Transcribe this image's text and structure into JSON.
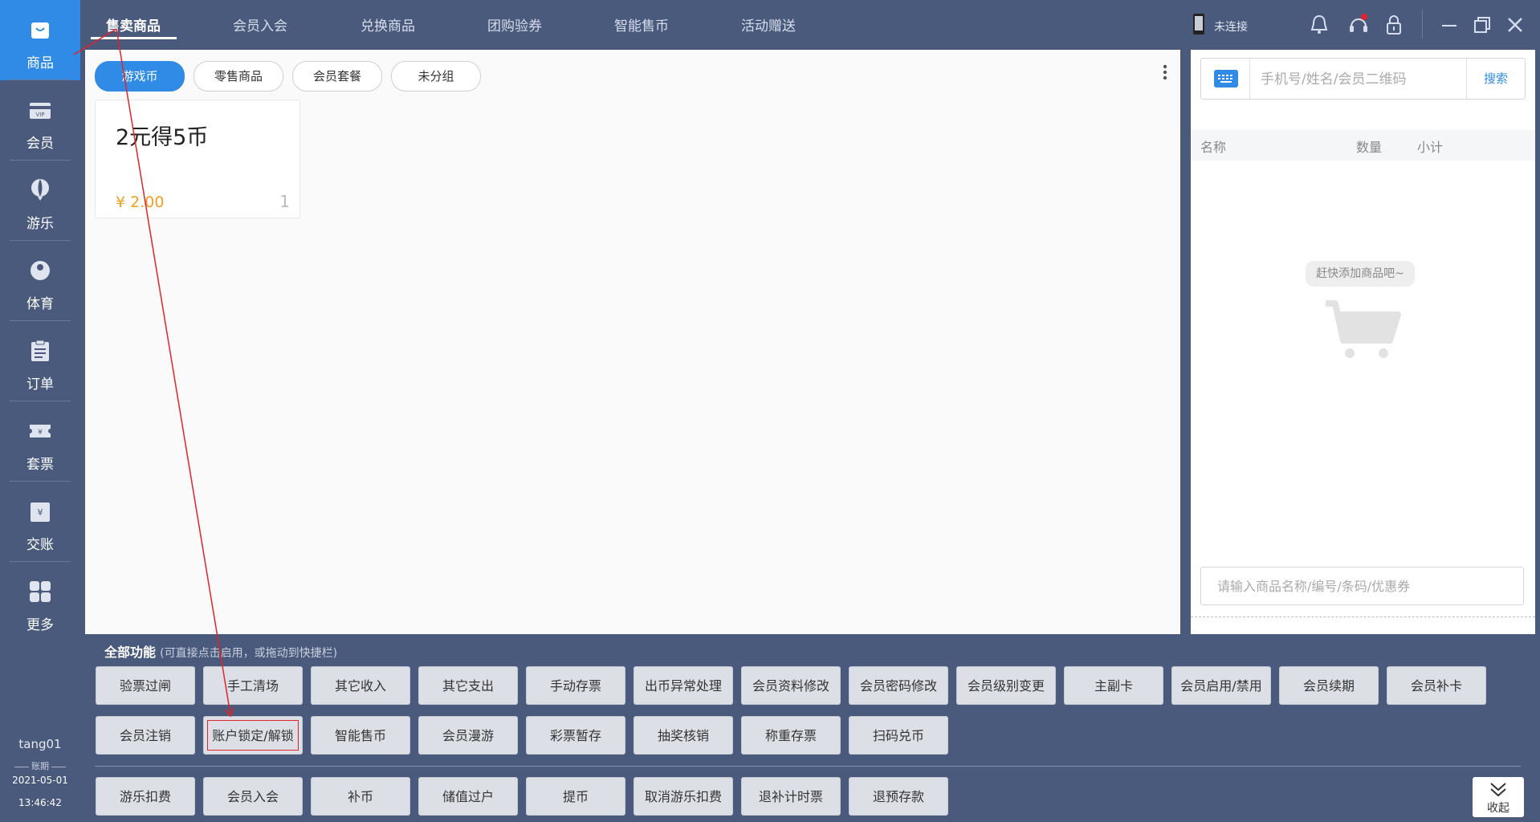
{
  "sidebar": {
    "items": [
      {
        "label": "商品",
        "icon": "shopping-bag-icon"
      },
      {
        "label": "会员",
        "icon": "vip-card-icon"
      },
      {
        "label": "游乐",
        "icon": "balloon-icon"
      },
      {
        "label": "体育",
        "icon": "billiard-ball-icon"
      },
      {
        "label": "订单",
        "icon": "clipboard-icon"
      },
      {
        "label": "套票",
        "icon": "ticket-icon"
      },
      {
        "label": "交账",
        "icon": "cash-icon"
      },
      {
        "label": "更多",
        "icon": "grid-icon"
      }
    ],
    "user": "tang01",
    "period_label": "账期",
    "period_date": "2021-05-01",
    "period_time": "13:46:42"
  },
  "top_tabs": [
    "售卖商品",
    "会员入会",
    "兑换商品",
    "团购验券",
    "智能售币",
    "活动赠送"
  ],
  "top_right": {
    "connection_status": "未连接"
  },
  "categories": [
    "游戏币",
    "零售商品",
    "会员套餐",
    "未分组"
  ],
  "product": {
    "name": "2元得5币",
    "price": "¥ 2.00",
    "qty": "1"
  },
  "right_panel": {
    "member_placeholder": "手机号/姓名/会员二维码",
    "search_label": "搜索",
    "cart_headers": [
      "名称",
      "数量",
      "小计"
    ],
    "empty_hint": "赶快添加商品吧~",
    "product_placeholder": "请输入商品名称/编号/条码/优惠券"
  },
  "functions": {
    "title": "全部功能",
    "hint": "(可直接点击启用，或拖动到快捷栏)",
    "row1": [
      "验票过闸",
      "手工清场",
      "其它收入",
      "其它支出",
      "手动存票",
      "出币异常处理",
      "会员资料修改",
      "会员密码修改",
      "会员级别变更",
      "主副卡",
      "会员启用/禁用",
      "会员续期",
      "会员补卡"
    ],
    "row2": [
      "会员注销",
      "账户锁定/解锁",
      "智能售币",
      "会员漫游",
      "彩票暂存",
      "抽奖核销",
      "称重存票",
      "扫码兑币"
    ],
    "quick": [
      "游乐扣费",
      "会员入会",
      "补币",
      "储值过户",
      "提币",
      "取消游乐扣费",
      "退补计时票",
      "退预存款"
    ],
    "collapse_label": "收起"
  },
  "colors": {
    "accent": "#2f8be6",
    "background": "#4a5a7c",
    "price": "#f0a020",
    "annotation": "#e0242b"
  }
}
